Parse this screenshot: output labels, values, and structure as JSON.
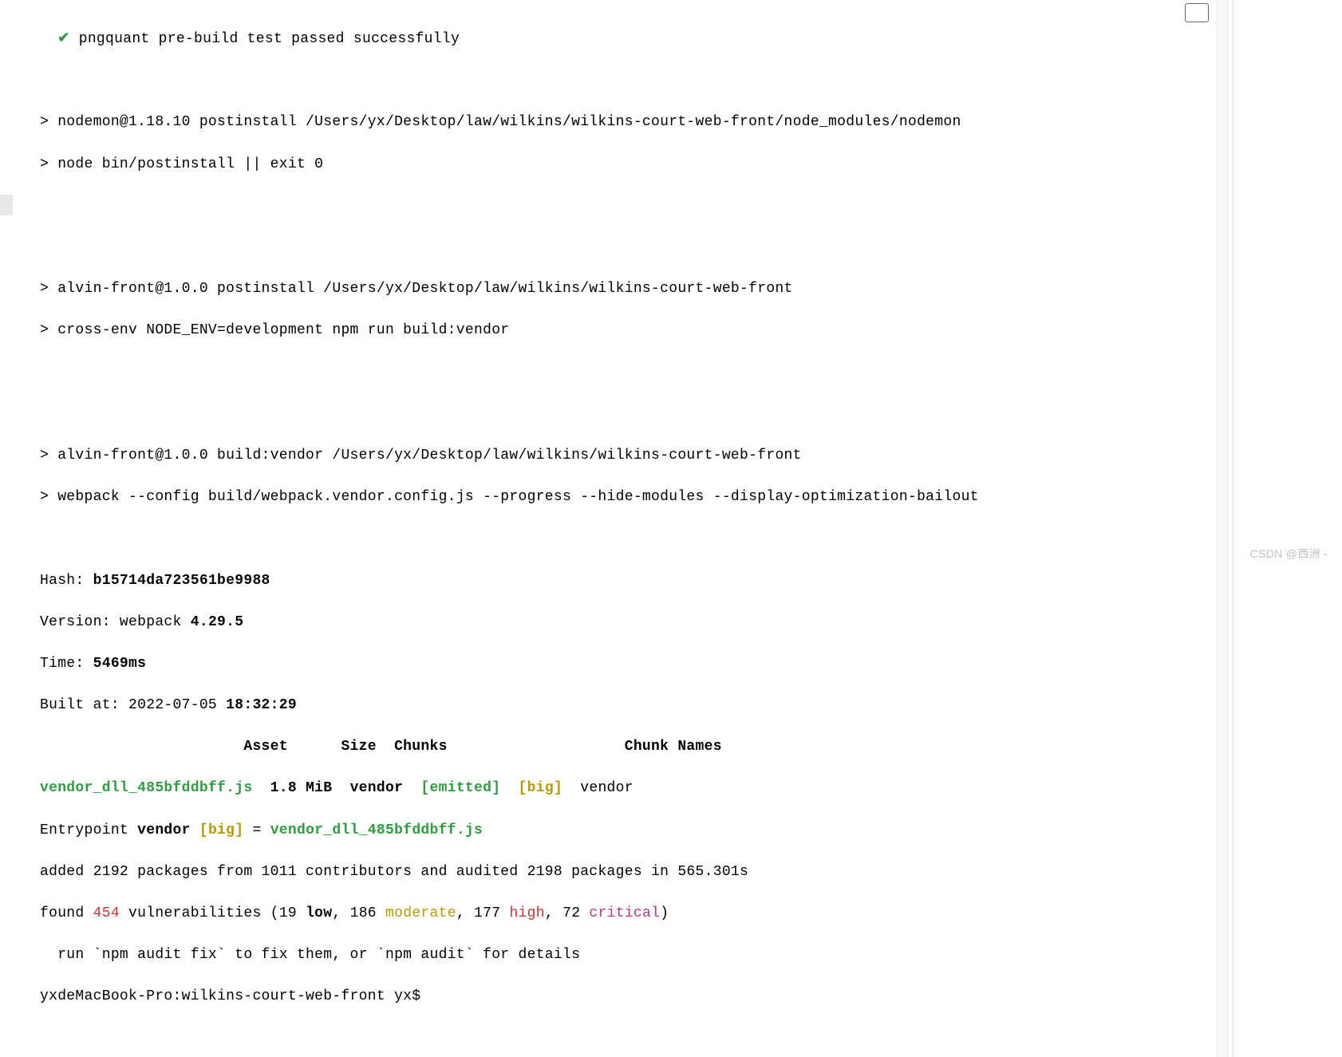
{
  "check_line": {
    "check": "✔",
    "text": " pngquant pre-build test passed successfully"
  },
  "cmd_blocks": [
    {
      "l1": "> nodemon@1.18.10 postinstall /Users/yx/Desktop/law/wilkins/wilkins-court-web-front/node_modules/nodemon",
      "l2": "> node bin/postinstall || exit 0"
    },
    {
      "l1": "> alvin-front@1.0.0 postinstall /Users/yx/Desktop/law/wilkins/wilkins-court-web-front",
      "l2": "> cross-env NODE_ENV=development npm run build:vendor"
    },
    {
      "l1": "> alvin-front@1.0.0 build:vendor /Users/yx/Desktop/law/wilkins/wilkins-court-web-front",
      "l2": "> webpack --config build/webpack.vendor.config.js --progress --hide-modules --display-optimization-bailout"
    }
  ],
  "build": {
    "hash_label": "Hash: ",
    "hash": "b15714da723561be9988",
    "version_label": "Version: webpack ",
    "version": "4.29.5",
    "time_label": "Time: ",
    "time": "5469ms",
    "built_at_label": "Built at: 2022-07-05 ",
    "built_at_time": "18:32:29"
  },
  "table": {
    "header": "                       Asset      Size  Chunks                    Chunk Names",
    "row": {
      "asset": "vendor_dll_485bfddbff.js",
      "size": "  1.8 MiB",
      "chunks": "  vendor  ",
      "emitted": "[emitted]",
      "big": "  [big]",
      "names": "  vendor"
    }
  },
  "entrypoint": {
    "prefix": "Entrypoint ",
    "name": "vendor",
    "big": " [big]",
    "eq": " = ",
    "file": "vendor_dll_485bfddbff.js"
  },
  "audit": {
    "added": "added 2192 packages from 1011 contributors and audited 2198 packages in 565.301s",
    "found1": "found ",
    "count": "454",
    "found2": " vulnerabilities (19 ",
    "low": "low",
    "found3": ", 186 ",
    "moderate": "moderate",
    "found4": ", 177 ",
    "high": "high",
    "found5": ", 72 ",
    "critical": "critical",
    "found6": ")",
    "fix": "  run `npm audit fix` to fix them, or `npm audit` for details"
  },
  "prompt": "yxdeMacBook-Pro:wilkins-court-web-front yx$ ",
  "watermark": "CSDN @西洲 -"
}
